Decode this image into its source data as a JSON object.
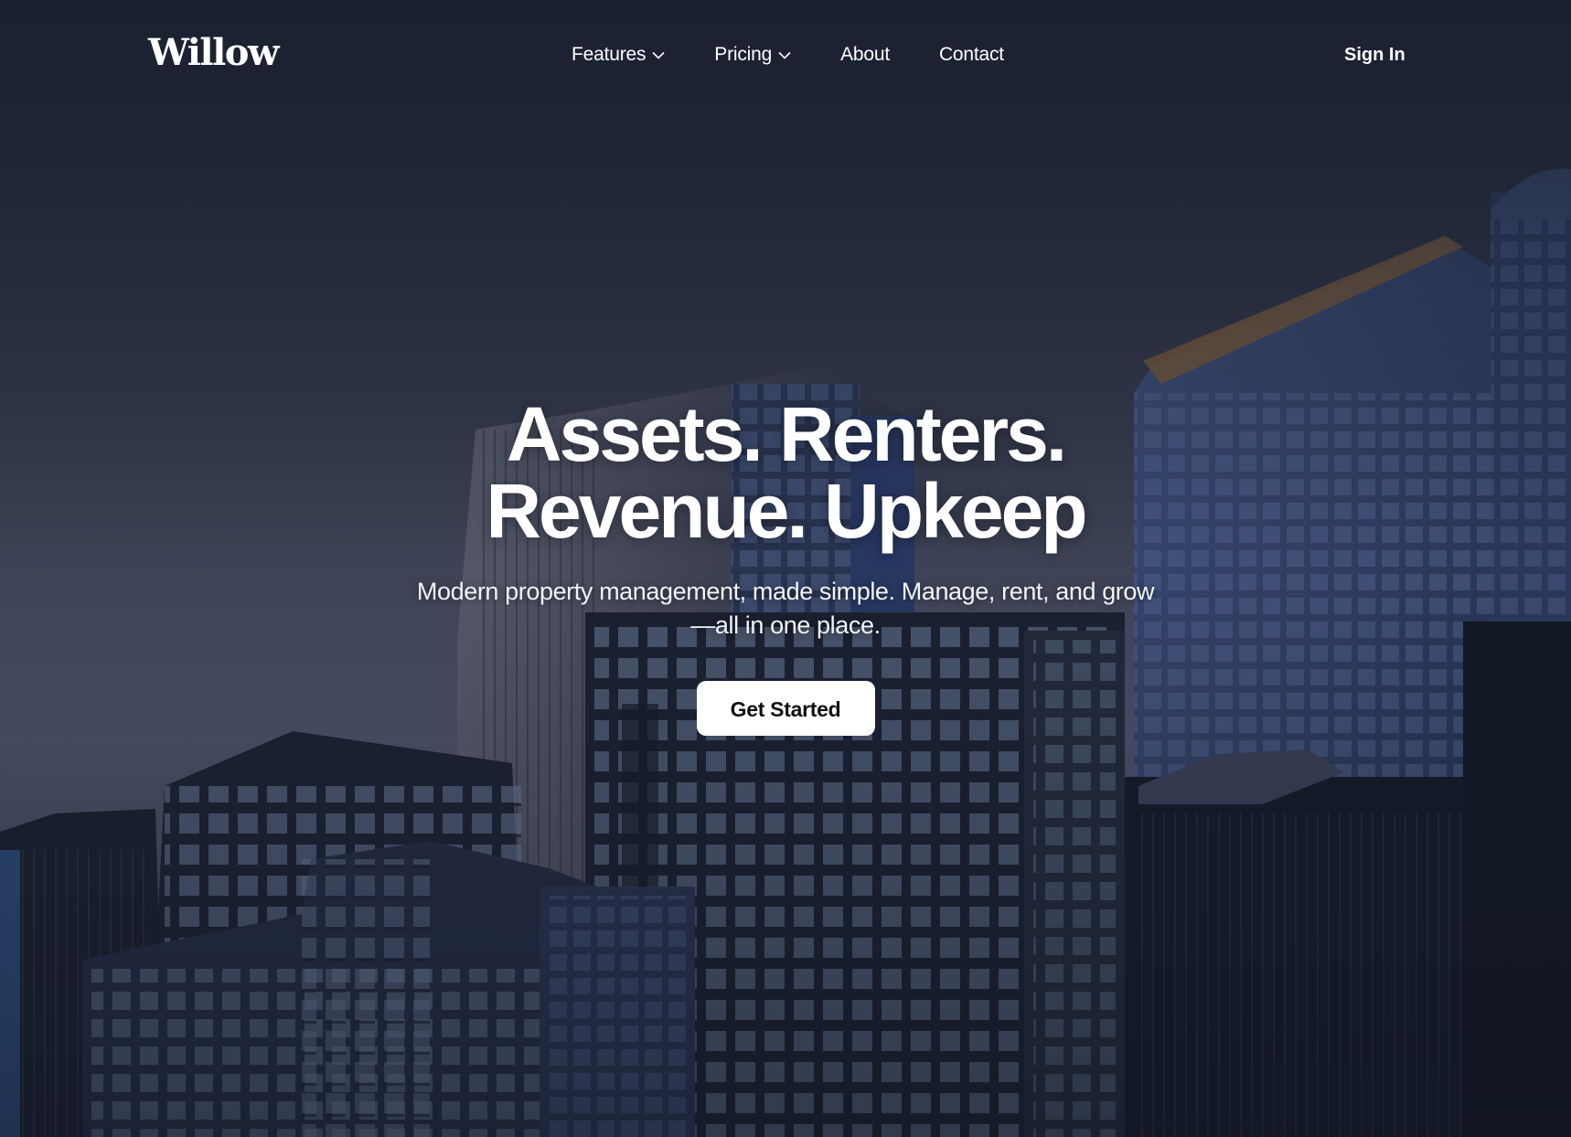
{
  "brand": {
    "logo_text": "Willow"
  },
  "nav": {
    "items": [
      {
        "label": "Features",
        "has_dropdown": true,
        "icon": "chevron-down-icon"
      },
      {
        "label": "Pricing",
        "has_dropdown": true,
        "icon": "chevron-down-icon"
      },
      {
        "label": "About",
        "has_dropdown": false
      },
      {
        "label": "Contact",
        "has_dropdown": false
      }
    ],
    "sign_in_label": "Sign In"
  },
  "hero": {
    "headline_line1": "Assets. Renters.",
    "headline_line2": "Revenue. Upkeep",
    "subtitle_line1": "Modern property management, made simple. Manage, rent, and grow",
    "subtitle_line2": "—all in one place.",
    "cta_label": "Get Started",
    "background_image": "city-high-rise-buildings-dusk"
  },
  "colors": {
    "sky_top": "#1c2233",
    "sky_mid": "#4a4f5f",
    "building_dark": "#151c2b",
    "building_blue": "#2c3d63",
    "cta_background": "#ffffff",
    "cta_text": "#111111"
  }
}
